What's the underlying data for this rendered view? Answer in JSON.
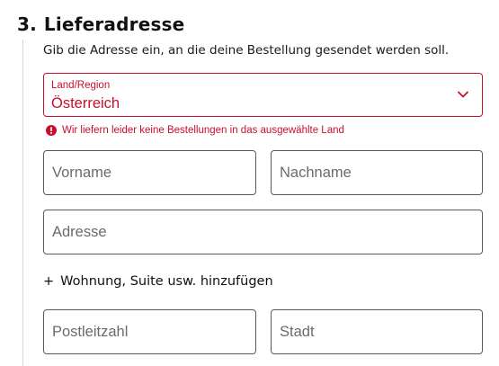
{
  "section": {
    "number": "3.",
    "title": "Lieferadresse",
    "intro": "Gib die Adresse ein, an die deine Bestellung gesendet werden soll."
  },
  "country": {
    "label": "Land/Region",
    "value": "Österreich",
    "error": "Wir liefern leider keine Bestellungen in das ausgewählte Land",
    "error_color": "#c8102e"
  },
  "fields": {
    "first_name_placeholder": "Vorname",
    "last_name_placeholder": "Nachname",
    "address_placeholder": "Adresse",
    "postal_code_placeholder": "Postleitzahl",
    "city_placeholder": "Stadt"
  },
  "add_apartment": {
    "plus": "+",
    "label": "Wohnung, Suite usw. hinzufügen"
  },
  "icons": {
    "dropdown": "chevron-down-icon",
    "error": "error-icon"
  }
}
